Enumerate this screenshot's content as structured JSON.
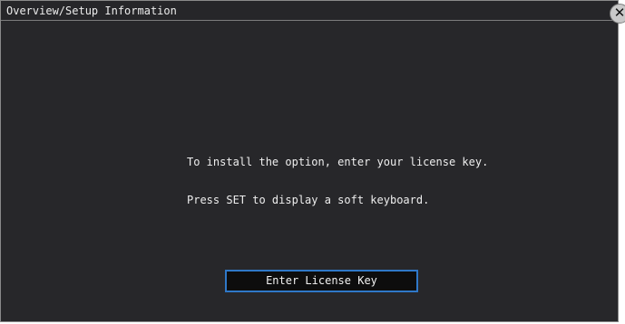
{
  "dialog": {
    "title": "Overview/Setup Information",
    "close_icon": "close-icon"
  },
  "message": {
    "line1": "To install the option, enter your license key.",
    "line2": "Press SET to display a soft keyboard."
  },
  "button": {
    "label": "Enter License Key"
  },
  "colors": {
    "panel_background": "#27272a",
    "button_background": "#0d0d0d",
    "button_border": "#2f78c8",
    "text": "#eeeeee"
  }
}
